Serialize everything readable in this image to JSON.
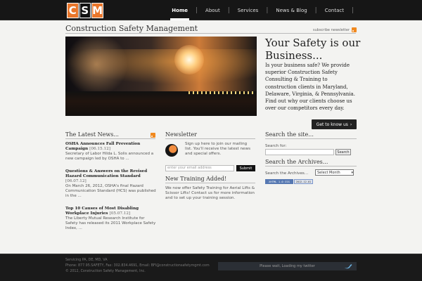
{
  "brand": {
    "logo_letters": [
      "C",
      "S",
      "M"
    ],
    "accent": "#e9762b"
  },
  "nav": {
    "items": [
      "Home",
      "About",
      "Services",
      "News & Blog",
      "Contact"
    ]
  },
  "site": {
    "title": "Construction Safety Management",
    "subscribe": "subscribe newsletter"
  },
  "hero": {
    "headline": "Your Safety is our Business...",
    "text": "Is your business safe? We provide superior Construction Safety Consulting & Training to construction clients in Maryland, Delaware, Virginia, & Pennsylvania. Find out why our clients choose us over our competitors every day.",
    "button": "Get to know us"
  },
  "latest_news": {
    "title": "The Latest News...",
    "items": [
      {
        "headline": "OSHA Announces Fall Prevention Campaign",
        "date": "[06.15.12]",
        "body": "Secretary of Labor Hilda L. Solis announced a new campaign led by OSHA to ..."
      },
      {
        "headline": "Questions & Answers on the Revised Hazard Communication Standard",
        "date": "[06.07.12]",
        "body": "On March 26, 2012, OSHA's final Hazard Communication Standard (HCS) was published in the ..."
      },
      {
        "headline": "Top 10 Causes of Most Disabling Workplace Injuries",
        "date": "[05.07.12]",
        "body": "The Liberty Mutual Research Institute for Safety has released its 2011 Workplace Safety Index, ..."
      }
    ]
  },
  "newsletter": {
    "title": "Newsletter",
    "text": "Sign up here to join our mailing list. You'll receive the latest news and special offers.",
    "placeholder": "enter your email address",
    "submit": "Submit"
  },
  "training": {
    "title": "New Training Added!",
    "text": "We now offer Safety Training for Aerial Lifts & Scissor Lifts! Contact us for more information and to set up your training session."
  },
  "search": {
    "title": "Search the site...",
    "label": "Search for:",
    "button": "Search"
  },
  "archives": {
    "title": "Search the Archives...",
    "label": "Search the Archives...",
    "select": "Select Month"
  },
  "badges": {
    "left": "XHTML 1.0 CSS",
    "right": "2012-12-01"
  },
  "footer": {
    "line1": "Servicing PA, DE, MD, VA",
    "line2": "Phone: 877.95.SAFETY, Fax: 302.834.4691, Email: BFI@constructionsafetymgmt.com",
    "line3": "© 2012, Construction Safety Management, Inc.",
    "twitter": "Please wait, Loading my twitter"
  }
}
